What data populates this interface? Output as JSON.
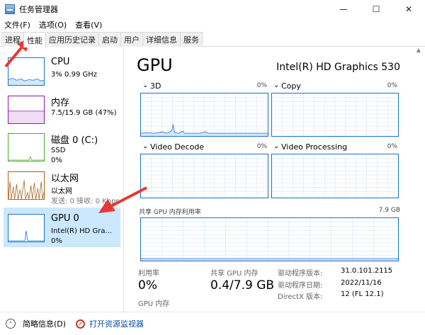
{
  "window": {
    "title": "任务管理器",
    "icon": "task-manager-icon",
    "controls": [
      "—",
      "☐",
      "✕"
    ]
  },
  "menu": [
    "文件(F)",
    "选项(O)",
    "查看(V)"
  ],
  "tabs": [
    {
      "label": "进程",
      "active": false
    },
    {
      "label": "性能",
      "active": true
    },
    {
      "label": "应用历史记录",
      "active": false
    },
    {
      "label": "启动",
      "active": false
    },
    {
      "label": "用户",
      "active": false
    },
    {
      "label": "详细信息",
      "active": false
    },
    {
      "label": "服务",
      "active": false
    }
  ],
  "sidebar": {
    "items": [
      {
        "name": "CPU",
        "sub1": "3%  0.99 GHz",
        "sub2": "",
        "color": "#1c6fc9"
      },
      {
        "name": "内存",
        "sub1": "7.5/15.9 GB (47%)",
        "sub2": "",
        "color": "#8b1aa8"
      },
      {
        "name": "磁盘 0 (C:)",
        "sub1": "SSD",
        "sub2": "0%",
        "color": "#4ea72e"
      },
      {
        "name": "以太网",
        "sub1": "以太网",
        "sub2": "发送: 0 接收: 0 Kbps",
        "color": "#a8621a"
      },
      {
        "name": "GPU 0",
        "sub1": "Intel(R) HD Gra...",
        "sub2": "0%",
        "color": "#1c6fc9",
        "selected": true
      }
    ]
  },
  "gpu": {
    "title": "GPU",
    "model": "Intel(R) HD Graphics 530",
    "graphs": [
      {
        "name": "3D",
        "percent": "0%"
      },
      {
        "name": "Copy",
        "percent": "0%"
      },
      {
        "name": "Video Decode",
        "percent": "0%"
      },
      {
        "name": "Video Processing",
        "percent": "0%"
      }
    ],
    "shared_memory_label": "共享 GPU 内存利用率",
    "shared_memory_max": "7.9 GB",
    "stats": {
      "utilization_label": "利用率",
      "utilization_value": "0%",
      "shared_mem_label": "共享 GPU 内存",
      "shared_mem_value": "0.4/7.9 GB",
      "gpu_mem_label": "GPU 内存"
    },
    "info": {
      "driver_version_key": "驱动程序版本:",
      "driver_version": "31.0.101.2115",
      "driver_date_key": "驱动程序日期:",
      "driver_date": "2022/11/16",
      "directx_key": "DirectX 版本:",
      "directx": "12 (FL 12.1)"
    }
  },
  "status": {
    "brief_label": "简略信息(D)",
    "monitor_label": "打开资源监视器"
  },
  "colors": {
    "accent_blue": "#1c6fc9",
    "selection": "#cce8ff",
    "arrow_red": "#e53935",
    "link": "#0b4ea2"
  }
}
